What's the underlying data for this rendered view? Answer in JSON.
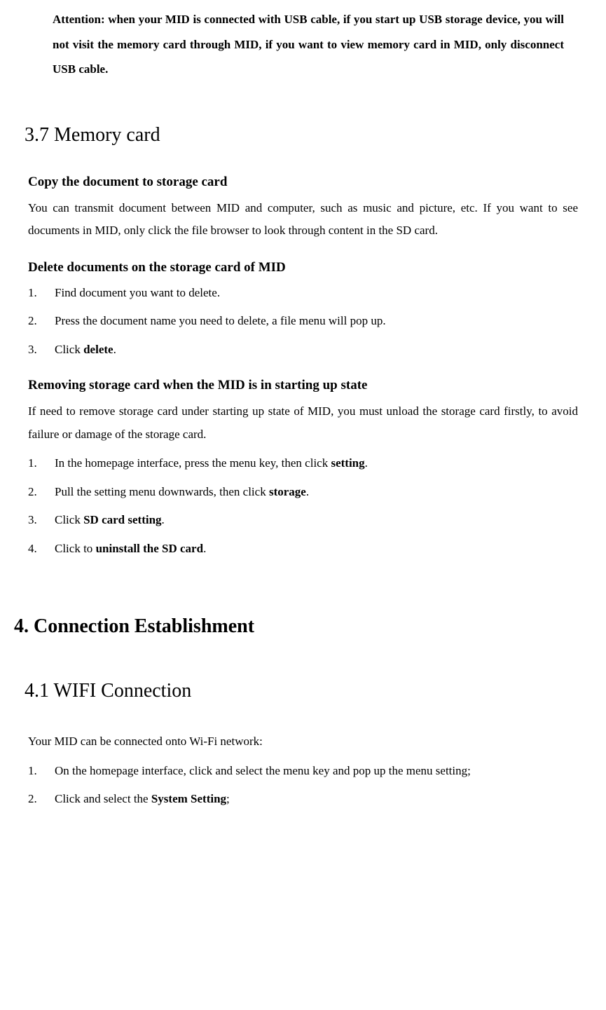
{
  "attention": "Attention: when your MID is connected with USB cable, if you start up USB storage device, you will not visit the memory card through MID, if you want to view memory card in MID, only disconnect USB cable.",
  "sec37": {
    "title": "3.7 Memory card",
    "copy": {
      "heading": "Copy the document to storage card",
      "body": "You can transmit document between MID and computer, such as music and picture, etc. If you want to see documents in MID, only click the file browser to look through content in the SD card."
    },
    "delete": {
      "heading": "Delete documents on the storage card of MID",
      "items": [
        {
          "n": "1.",
          "t": "Find document you want to delete."
        },
        {
          "n": "2.",
          "t": "Press the document name you need to delete, a file menu will pop up."
        },
        {
          "n": "3.",
          "pre": "Click ",
          "bold": "delete",
          "post": "."
        }
      ]
    },
    "remove": {
      "heading": "Removing storage card when the MID is in starting up state",
      "body": "If need to remove storage card under starting up state of MID, you must unload the storage card firstly, to avoid failure or damage of the storage card.",
      "items": [
        {
          "n": "1.",
          "pre": "In the homepage interface, press the menu key, then click ",
          "bold": "setting",
          "post": "."
        },
        {
          "n": "2.",
          "pre": "Pull the setting menu downwards, then click ",
          "bold": "storage",
          "post": "."
        },
        {
          "n": "3.",
          "pre": "Click ",
          "bold": "SD card setting",
          "post": "."
        },
        {
          "n": "4.",
          "pre": "Click to ",
          "bold": "uninstall the SD card",
          "post": "."
        }
      ]
    }
  },
  "chap4": {
    "title": "4. Connection Establishment",
    "sec41": {
      "title": "4.1 WIFI Connection",
      "intro": "Your MID can be connected onto Wi-Fi network:",
      "items": [
        {
          "n": "1.",
          "t": "On the homepage interface, click and select the menu key and pop up the menu setting;"
        },
        {
          "n": "2.",
          "pre": "Click and select the ",
          "bold": "System Setting",
          "post": ";"
        }
      ]
    }
  }
}
